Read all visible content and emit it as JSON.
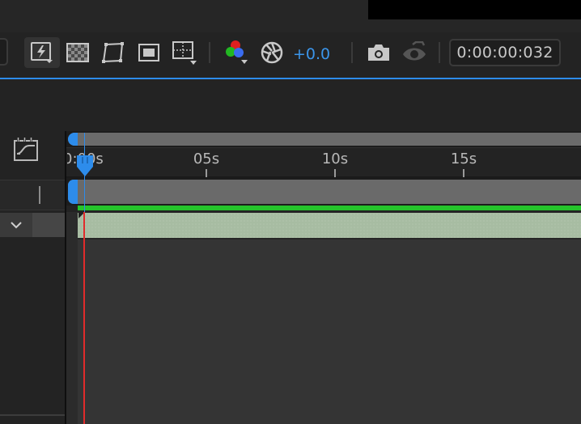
{
  "toolbar": {
    "tools": [
      {
        "id": "fast-previews",
        "icon": "lightning-icon"
      },
      {
        "id": "transparency-grid",
        "icon": "checkerboard-icon"
      },
      {
        "id": "mask-visibility",
        "icon": "mask-path-icon"
      },
      {
        "id": "region-of-interest",
        "icon": "region-icon"
      },
      {
        "id": "grid-guides",
        "icon": "grid-guides-icon"
      },
      {
        "id": "channels",
        "icon": "rgb-channels-icon"
      },
      {
        "id": "reset-exposure",
        "icon": "aperture-icon"
      }
    ],
    "exposure": "+0.0",
    "snapshot_icon": "camera-icon",
    "show_snapshot_icon": "eye-snapshot-icon",
    "timecode": "0:00:00:032"
  },
  "timeline": {
    "ruler_labels": [
      {
        "label": "0:00s",
        "seconds": 0
      },
      {
        "label": "05s",
        "seconds": 5
      },
      {
        "label": "10s",
        "seconds": 10
      },
      {
        "label": "15s",
        "seconds": 15
      }
    ],
    "current_time_seconds": 0.03
  },
  "colors": {
    "accent": "#2d8ceb",
    "playhead": "#e12b2b",
    "layer_bar": "#a7bca2",
    "label_green": "#25c42b"
  }
}
